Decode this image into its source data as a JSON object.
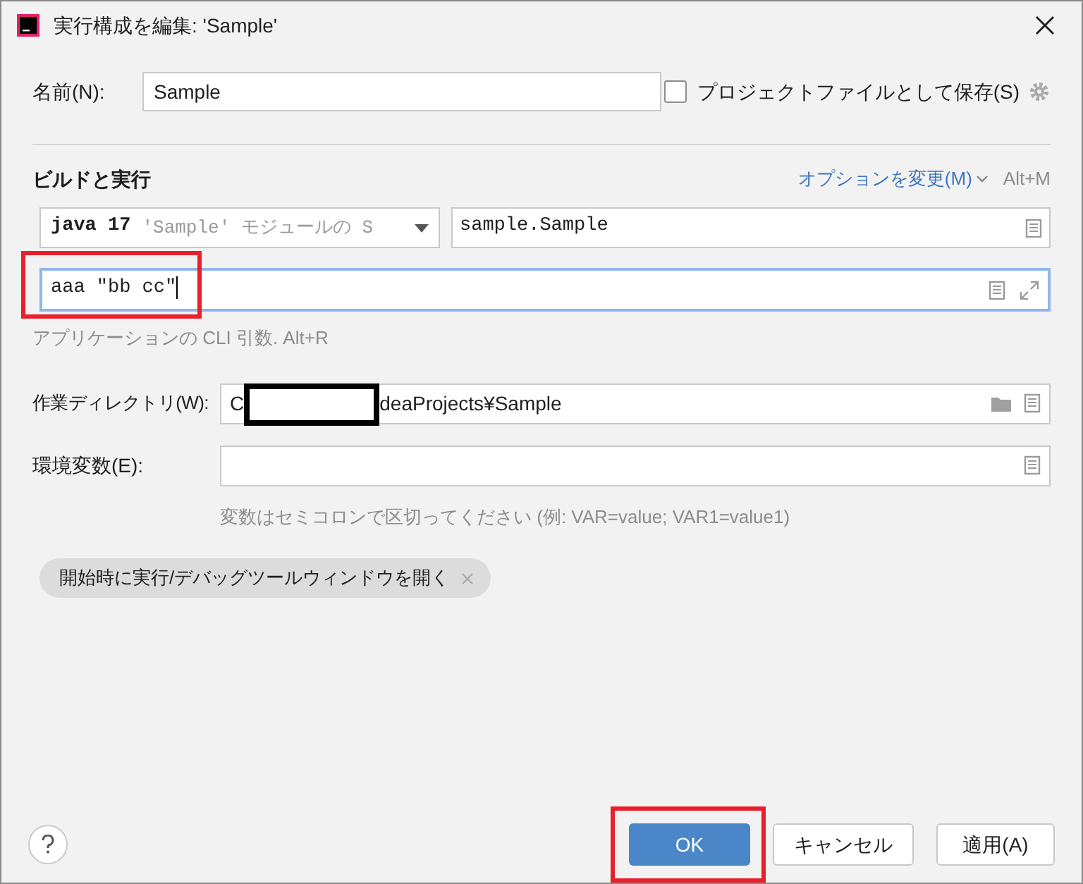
{
  "window": {
    "title": "実行構成を編集: 'Sample'"
  },
  "name": {
    "label": "名前(N):",
    "value": "Sample"
  },
  "store_as_project_file": {
    "label": "プロジェクトファイルとして保存(S)",
    "checked": false
  },
  "section": {
    "title": "ビルドと実行",
    "options_link": "オプションを変更(M)",
    "shortcut": "Alt+M"
  },
  "jre": {
    "main": "java 17",
    "detail": "'Sample' モジュールの S"
  },
  "main_class": {
    "value": "sample.Sample"
  },
  "program_args": {
    "value": "aaa \"bb cc\"",
    "focused": true,
    "highlighted": true,
    "hint": "アプリケーションの CLI 引数. Alt+R"
  },
  "working_dir": {
    "label": "作業ディレクトリ(W):",
    "value_start": "C",
    "value_end": "deaProjects¥Sample",
    "redacted": true
  },
  "env_vars": {
    "label": "環境変数(E):",
    "hint": "変数はセミコロンで区切ってください (例: VAR=value; VAR1=value1)"
  },
  "chips": [
    {
      "label": "開始時に実行/デバッグツールウィンドウを開く"
    }
  ],
  "buttons": [
    {
      "label": "OK",
      "kind": "primary",
      "highlighted": true
    },
    {
      "label": "キャンセル",
      "kind": "secondary",
      "highlighted": false
    },
    {
      "label": "適用(A)",
      "kind": "secondary",
      "highlighted": false
    }
  ]
}
